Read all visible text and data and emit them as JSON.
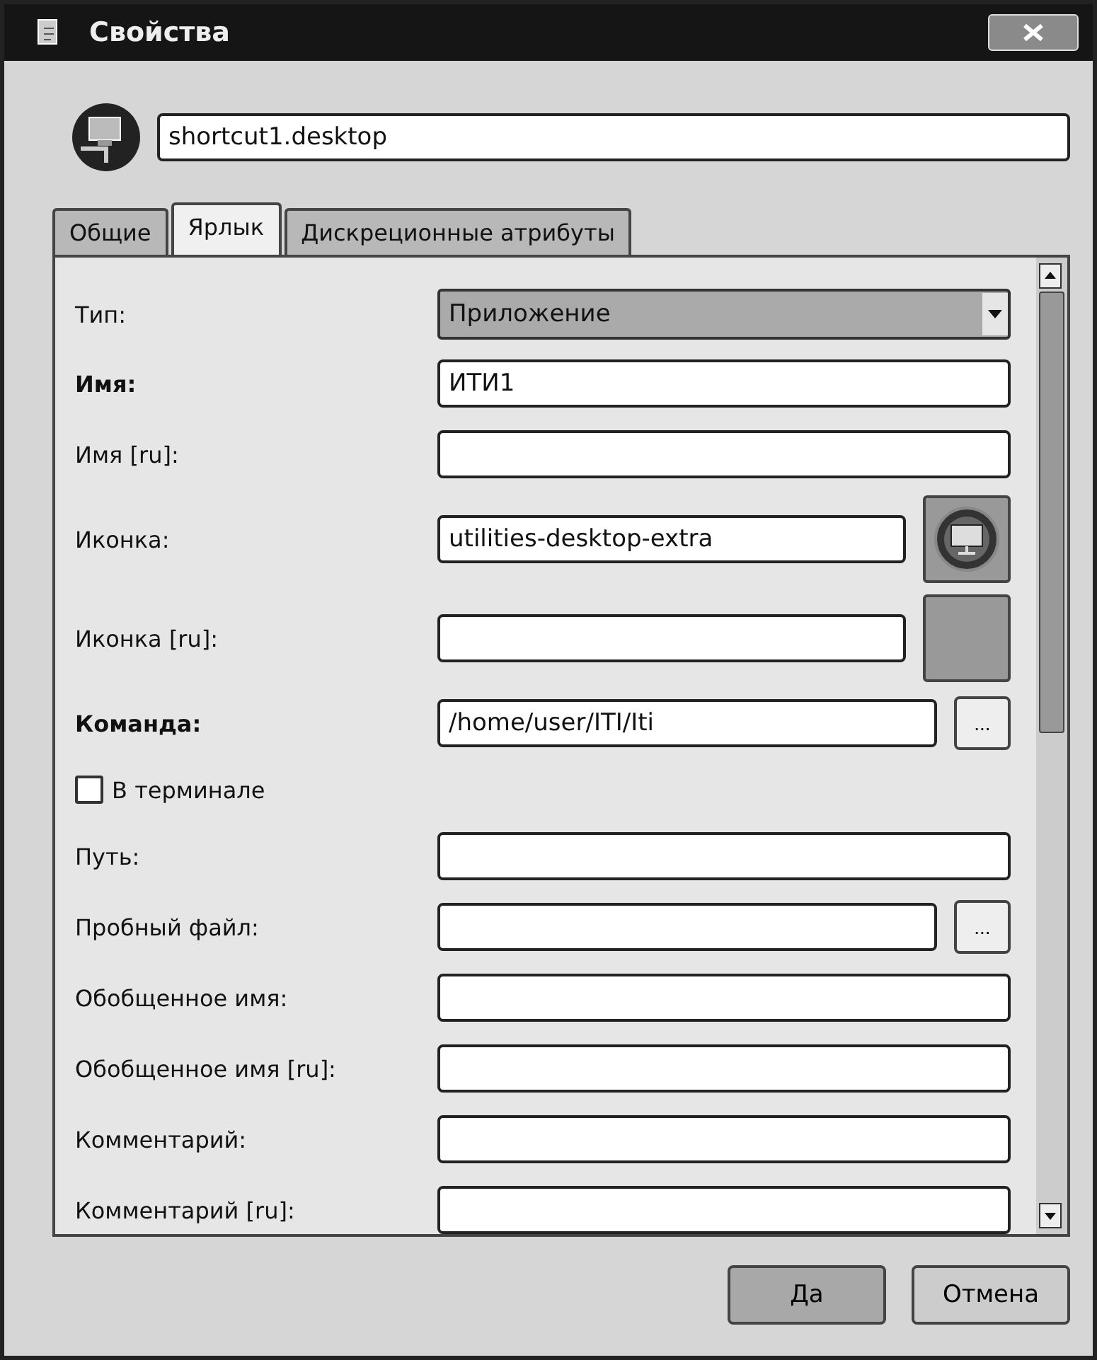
{
  "window": {
    "title": "Свойства"
  },
  "name_field": {
    "value": "shortcut1.desktop"
  },
  "tabs": [
    {
      "label": "Общие",
      "selected": false
    },
    {
      "label": "Ярлык",
      "selected": true
    },
    {
      "label": "Дискреционные атрибуты",
      "selected": false
    }
  ],
  "rows": [
    {
      "kind": "select",
      "label": "Тип:",
      "bold": false,
      "value": "Приложение"
    },
    {
      "kind": "field",
      "label": "Имя:",
      "bold": true,
      "value": "ИТИ1"
    },
    {
      "kind": "field",
      "label": "Имя [ru]:",
      "bold": false,
      "value": ""
    },
    {
      "kind": "field_icon",
      "label": "Иконка:",
      "bold": false,
      "value": "utilities-desktop-extra"
    },
    {
      "kind": "field_swatch",
      "label": "Иконка [ru]:",
      "bold": false,
      "value": ""
    },
    {
      "kind": "field_browse",
      "label": "Команда:",
      "bold": true,
      "value": "/home/user/ITI/Iti",
      "browse": "..."
    },
    {
      "kind": "checkbox",
      "label": "В терминале",
      "checked": false
    },
    {
      "kind": "field",
      "label": "Путь:",
      "bold": false,
      "value": ""
    },
    {
      "kind": "field_browse",
      "label": "Пробный файл:",
      "bold": false,
      "value": "",
      "browse": "..."
    },
    {
      "kind": "field",
      "label": "Обобщенное имя:",
      "bold": false,
      "value": ""
    },
    {
      "kind": "field",
      "label": "Обобщенное имя [ru]:",
      "bold": false,
      "value": ""
    },
    {
      "kind": "field",
      "label": "Комментарий:",
      "bold": false,
      "value": ""
    },
    {
      "kind": "field",
      "label": "Комментарий [ru]:",
      "bold": false,
      "value": ""
    }
  ],
  "buttons": [
    {
      "label": "Да",
      "kind": "default"
    },
    {
      "label": "Отмена",
      "kind": "normal"
    }
  ]
}
